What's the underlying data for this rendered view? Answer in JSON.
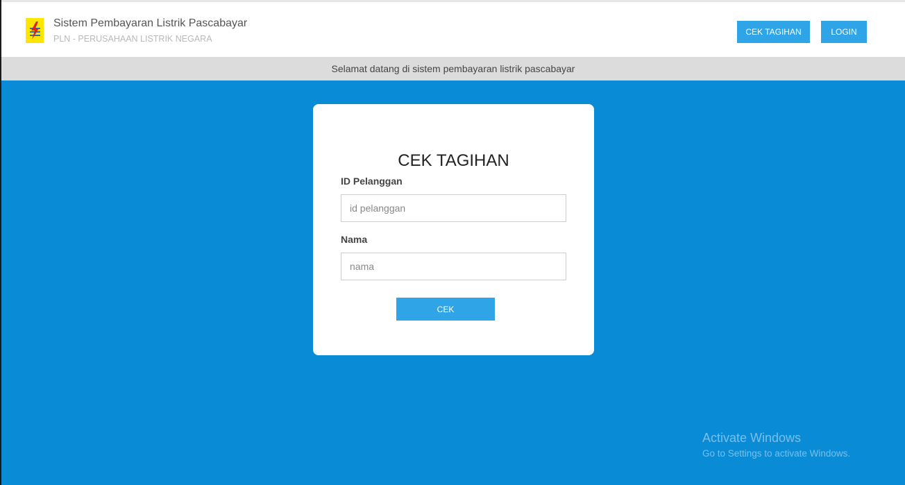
{
  "header": {
    "title": "Sistem Pembayaran Listrik Pascabayar",
    "subtitle": "PLN - PERUSAHAAN LISTRIK NEGARA",
    "logo_icon": "pln-lightning-logo-icon",
    "nav": {
      "cek_tagihan_label": "CEK TAGIHAN",
      "login_label": "LOGIN"
    }
  },
  "banner": {
    "text": "Selamat datang di sistem pembayaran listrik pascabayar"
  },
  "form": {
    "title": "CEK TAGIHAN",
    "id_label": "ID Pelanggan",
    "id_placeholder": "id pelanggan",
    "id_value": "",
    "nama_label": "Nama",
    "nama_placeholder": "nama",
    "nama_value": "",
    "submit_label": "CEK"
  },
  "watermark": {
    "title": "Activate Windows",
    "subtitle": "Go to Settings to activate Windows."
  },
  "colors": {
    "background": "#0a8bd6",
    "accent": "#2fa4e7",
    "banner": "#dcdcdc",
    "logo_yellow": "#ffe600",
    "logo_red": "#e0201b"
  }
}
